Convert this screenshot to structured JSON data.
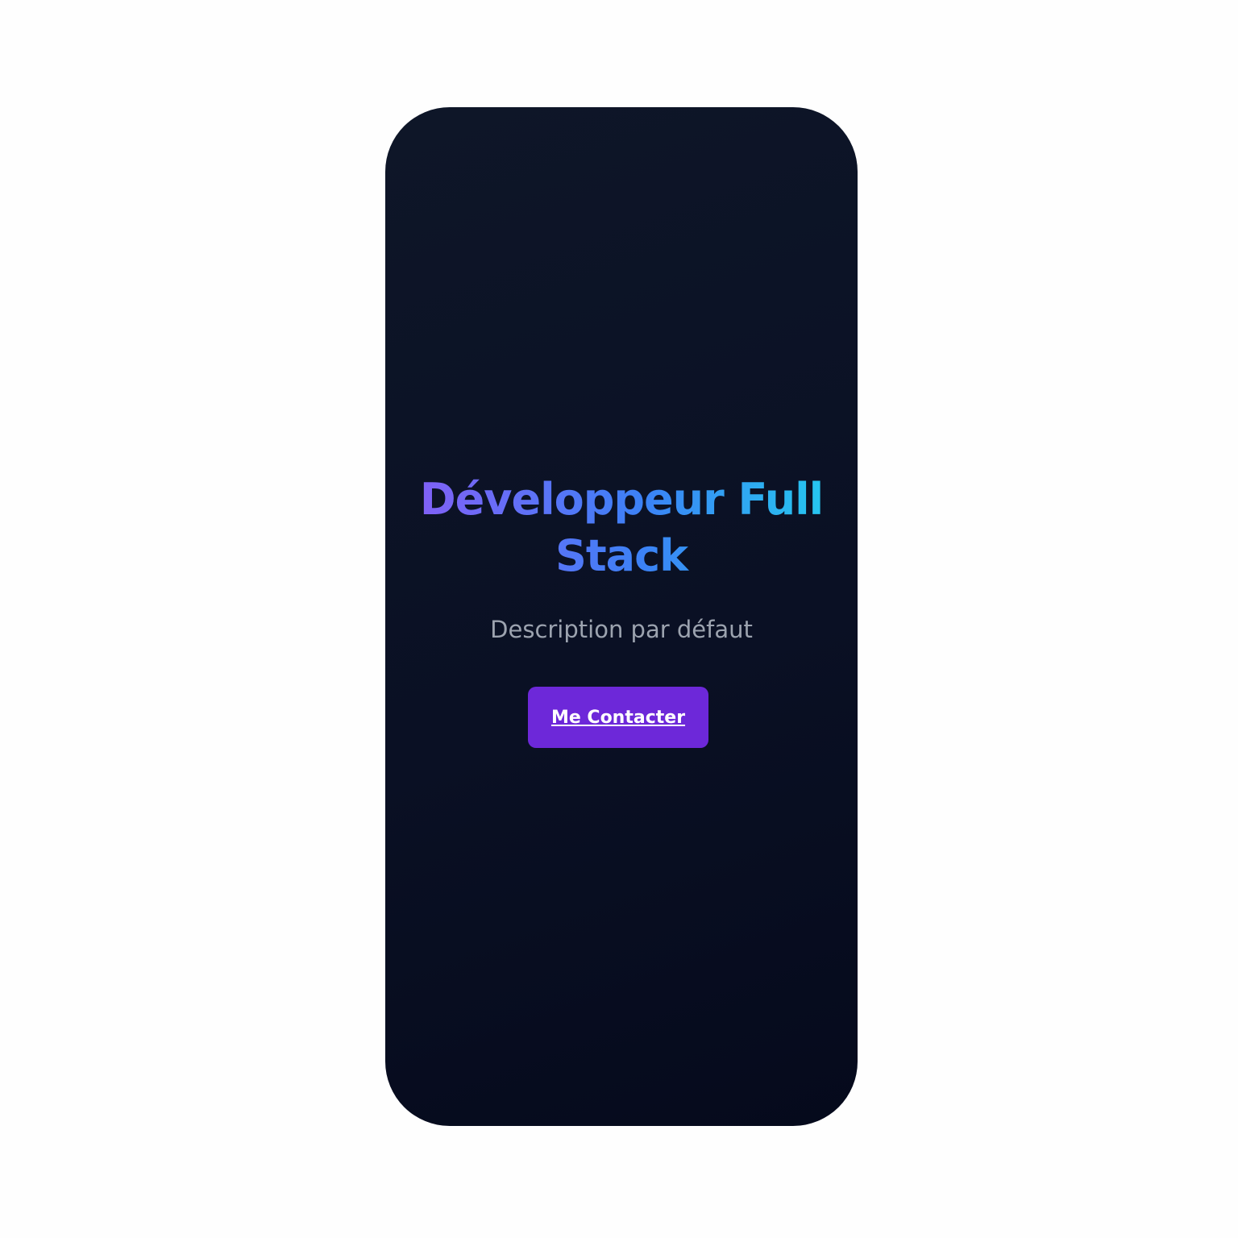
{
  "hero": {
    "title": "Développeur Full Stack",
    "description": "Description par défaut",
    "cta_label": "Me Contacter"
  },
  "colors": {
    "page_background": "#fefefe",
    "card_background": "#0a1024",
    "title_gradient_start": "#8b5cf6",
    "title_gradient_mid": "#3b82f6",
    "title_gradient_end": "#22d3ee",
    "description_text": "#9ca3af",
    "cta_background": "#6d28d9",
    "cta_text": "#ffffff"
  }
}
